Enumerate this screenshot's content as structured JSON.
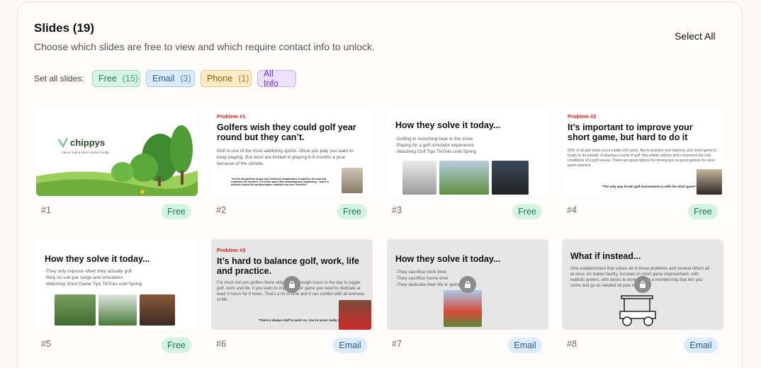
{
  "header": {
    "title": "Slides (19)",
    "subtitle": "Choose which slides are free to view and which require contact info to unlock.",
    "select_all": "Select All"
  },
  "set_all": {
    "label": "Set all slides:",
    "chips": [
      {
        "label": "Free",
        "count": "(15)"
      },
      {
        "label": "Email",
        "count": "(3)"
      },
      {
        "label": "Phone",
        "count": "(1)"
      },
      {
        "label": "All Info",
        "count": ""
      }
    ]
  },
  "slides": [
    {
      "number": "#1",
      "access": "Free",
      "logo": "chippys",
      "tagline": "Indoor Golf & Short Game Facility"
    },
    {
      "number": "#2",
      "access": "Free",
      "tag": "Problem #1",
      "heading": "Golfers wish they could golf year round but they can’t.",
      "body": "Golf is one of the most addicting sports. Once you play you want to keep playing. But most are limited to playing 6-9 months a year because of the climate.",
      "quote": "“Golf is deceptively simple and endlessly complicated; it satisfies the soul and frustrates the intellect. It is at the same time rewarding and maddening – and it is without a doubt the greatest game mankind has ever invented.”"
    },
    {
      "number": "#3",
      "access": "Free",
      "heading": "How they solve it today...",
      "lines": [
        "-Golfing in scorching heat or the snow",
        "-Paying for a golf simulator experience",
        "-Watching Golf Tips TikToks until Spring"
      ]
    },
    {
      "number": "#4",
      "access": "Free",
      "tag": "Problem #2",
      "heading": "It’s important to improve your short game, but hard to do it",
      "body": "65% of all golf shots occur inside 100 yards. But to practice and improve your short game is tough to do outside of playing a round of golf. Any viable options don’t represent the real conditions of a golf course. There are good options for driving but no good options for short game practice.",
      "quote": "“The only way to win golf tournaments is with the short game”"
    },
    {
      "number": "#5",
      "access": "Free",
      "heading": "How they solve it today...",
      "lines": [
        "-They only improve when they actually golf",
        "-Rely on sub-par range and simulators",
        "-Watching Short Game Tips TikToks until Spring"
      ]
    },
    {
      "number": "#6",
      "access": "Email",
      "tag": "Problem #3",
      "heading": "It’s hard to balance golf, work, life and practice.",
      "body": "For most non-pro golfers there simply isn’t enough hours in the day to juggle golf, work and life. If you want to improve your game you need to dedicate at least 3 hours for 9 holes. That’s a lot of time and it can conflict with all avenues of life.",
      "quote": "“There’s always stuff to work on. You’re never really there.”"
    },
    {
      "number": "#7",
      "access": "Email",
      "heading": "How they solve it today...",
      "lines": [
        "-They sacrifice work time",
        "-They sacrifice home time",
        "-They dedicate their life to going pro"
      ]
    },
    {
      "number": "#8",
      "access": "Email",
      "heading": "What if instead...",
      "body": "One establishment that solves all of these problems and several others all at once. An indoor facility, focused on short game improvement, with realistic greens, with desks to work at, and a membership that lets you come and go as needed all year long..."
    }
  ],
  "colors": {
    "free": "#1f7a4c",
    "email": "#2b5f8e",
    "phone": "#8a5a10",
    "all_info": "#6b36c3",
    "problem_red": "#e01b1b"
  }
}
